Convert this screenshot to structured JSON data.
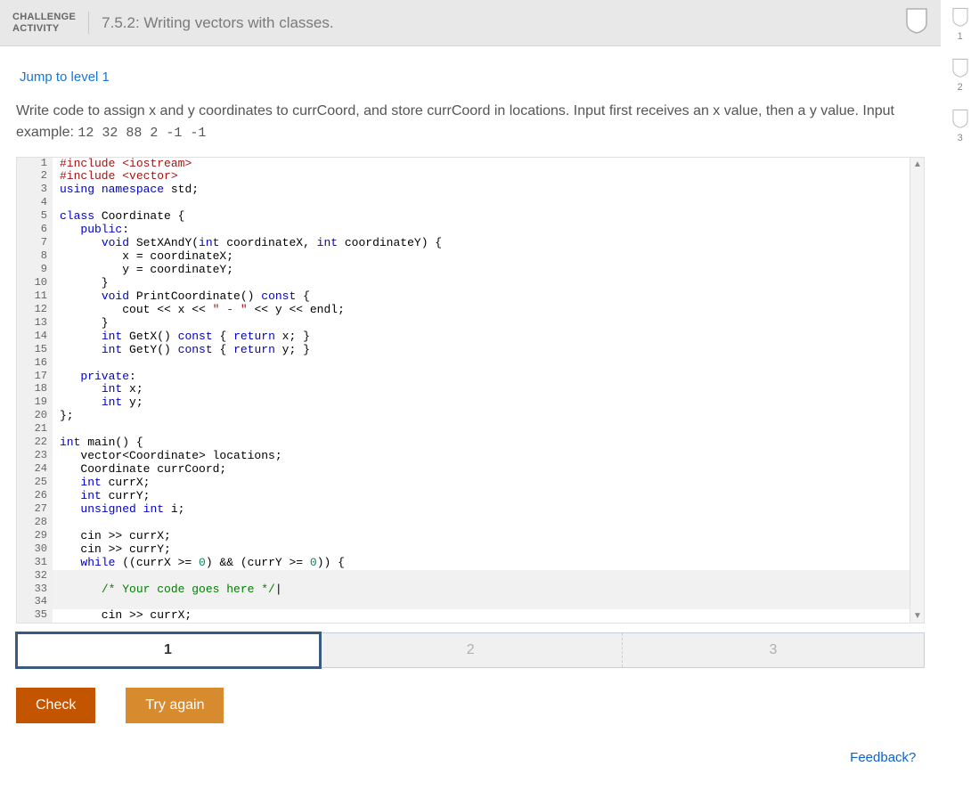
{
  "header": {
    "badge_line1": "CHALLENGE",
    "badge_line2": "ACTIVITY",
    "title": "7.5.2: Writing vectors with classes."
  },
  "jump_link": "Jump to level 1",
  "instructions": {
    "text": "Write code to assign x and y coordinates to currCoord, and store currCoord in locations. Input first receives an x value, then a y value. Input example: ",
    "example": "12 32 88 2 -1 -1"
  },
  "code_lines": [
    {
      "n": 1,
      "html": "<span class='pp'>#include</span> <span class='str'>&lt;iostream&gt;</span>"
    },
    {
      "n": 2,
      "html": "<span class='pp'>#include</span> <span class='str'>&lt;vector&gt;</span>"
    },
    {
      "n": 3,
      "html": "<span class='kw'>using</span> <span class='kw'>namespace</span> std;"
    },
    {
      "n": 4,
      "html": ""
    },
    {
      "n": 5,
      "html": "<span class='kw'>class</span> Coordinate {"
    },
    {
      "n": 6,
      "html": "   <span class='kw'>public</span>:"
    },
    {
      "n": 7,
      "html": "      <span class='ty'>void</span> SetXAndY(<span class='ty'>int</span> coordinateX, <span class='ty'>int</span> coordinateY) {"
    },
    {
      "n": 8,
      "html": "         x = coordinateX;"
    },
    {
      "n": 9,
      "html": "         y = coordinateY;"
    },
    {
      "n": 10,
      "html": "      }"
    },
    {
      "n": 11,
      "html": "      <span class='ty'>void</span> PrintCoordinate() <span class='kw'>const</span> {"
    },
    {
      "n": 12,
      "html": "         cout &lt;&lt; x &lt;&lt; <span class='str'>\" - \"</span> &lt;&lt; y &lt;&lt; endl;"
    },
    {
      "n": 13,
      "html": "      }"
    },
    {
      "n": 14,
      "html": "      <span class='ty'>int</span> GetX() <span class='kw'>const</span> { <span class='kw'>return</span> x; }"
    },
    {
      "n": 15,
      "html": "      <span class='ty'>int</span> GetY() <span class='kw'>const</span> { <span class='kw'>return</span> y; }"
    },
    {
      "n": 16,
      "html": ""
    },
    {
      "n": 17,
      "html": "   <span class='kw'>private</span>:"
    },
    {
      "n": 18,
      "html": "      <span class='ty'>int</span> x;"
    },
    {
      "n": 19,
      "html": "      <span class='ty'>int</span> y;"
    },
    {
      "n": 20,
      "html": "};"
    },
    {
      "n": 21,
      "html": ""
    },
    {
      "n": 22,
      "html": "<span class='ty'>int</span> main() {"
    },
    {
      "n": 23,
      "html": "   vector&lt;Coordinate&gt; locations;"
    },
    {
      "n": 24,
      "html": "   Coordinate currCoord;"
    },
    {
      "n": 25,
      "html": "   <span class='ty'>int</span> currX;"
    },
    {
      "n": 26,
      "html": "   <span class='ty'>int</span> currY;"
    },
    {
      "n": 27,
      "html": "   <span class='ty'>unsigned</span> <span class='ty'>int</span> i;"
    },
    {
      "n": 28,
      "html": ""
    },
    {
      "n": 29,
      "html": "   cin &gt;&gt; currX;"
    },
    {
      "n": 30,
      "html": "   cin &gt;&gt; currY;"
    },
    {
      "n": 31,
      "html": "   <span class='kw'>while</span> ((currX &gt;= <span class='num'>0</span>) &amp;&amp; (currY &gt;= <span class='num'>0</span>)) {"
    },
    {
      "n": 32,
      "html": "",
      "hl": true
    },
    {
      "n": 33,
      "html": "      <span class='cm'>/* Your code goes here */</span>|",
      "hl": true
    },
    {
      "n": 34,
      "html": "",
      "hl": true
    },
    {
      "n": 35,
      "html": "      cin &gt;&gt; currX;"
    }
  ],
  "level_tabs": [
    "1",
    "2",
    "3"
  ],
  "active_tab_index": 0,
  "buttons": {
    "check": "Check",
    "try_again": "Try again"
  },
  "feedback_label": "Feedback?",
  "progress_badges": [
    "1",
    "2",
    "3"
  ],
  "icons": {
    "scroll_up": "▲",
    "scroll_down": "▼"
  }
}
